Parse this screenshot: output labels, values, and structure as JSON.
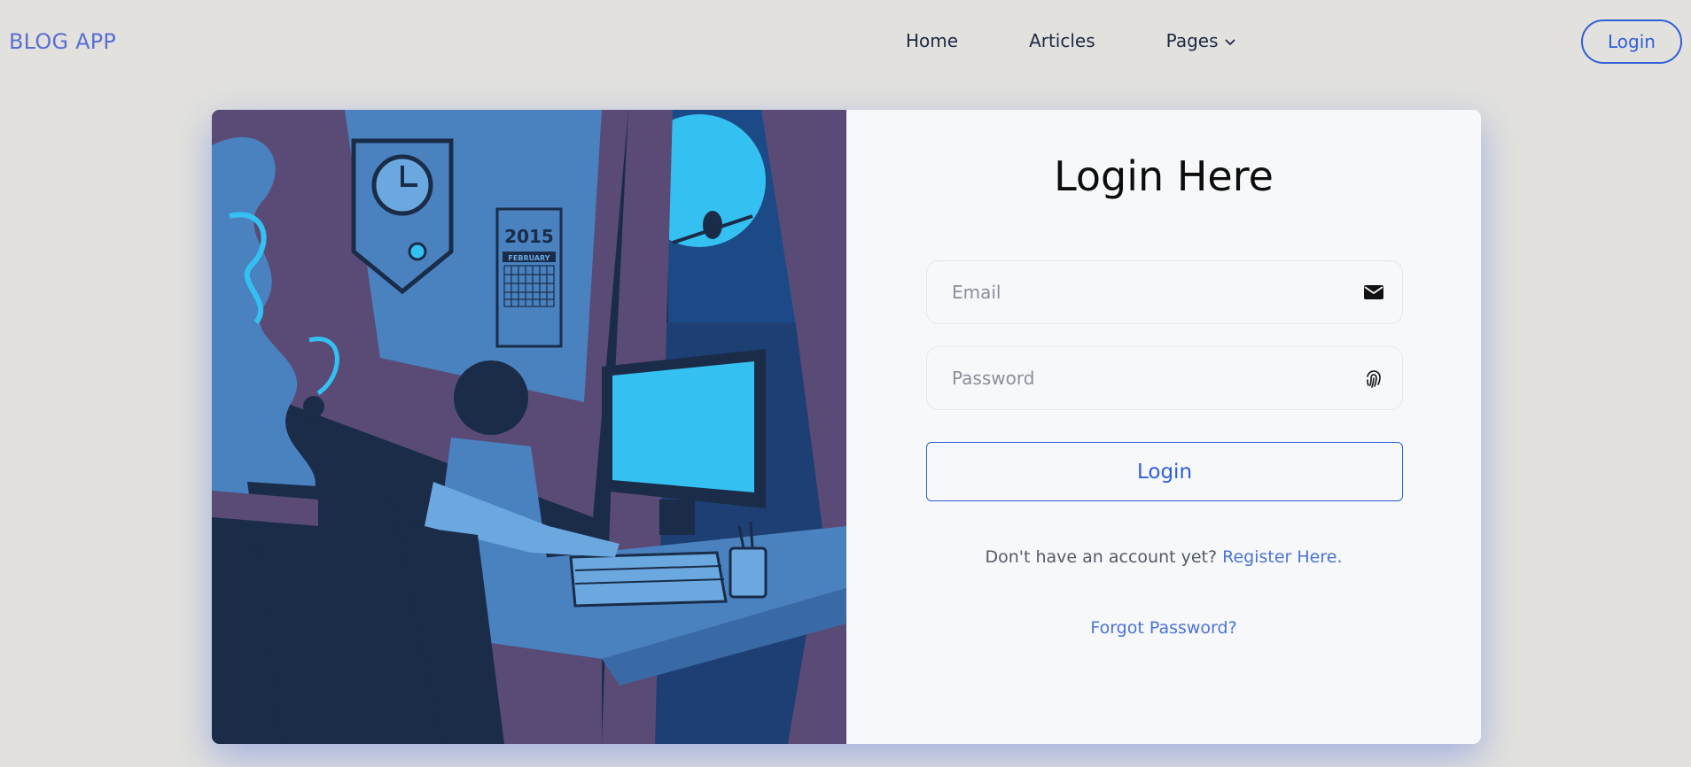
{
  "navbar": {
    "brand": "BLOG APP",
    "links": [
      {
        "label": "Home"
      },
      {
        "label": "Articles"
      },
      {
        "label": "Pages",
        "icon": "chevron-down-icon"
      }
    ],
    "login_label": "Login"
  },
  "illustration": {
    "calendar_year": "2015",
    "calendar_month": "FEBRUARY"
  },
  "form": {
    "title": "Login Here",
    "email_placeholder": "Email",
    "email_icon": "envelope-icon",
    "password_placeholder": "Password",
    "password_icon": "fingerprint-icon",
    "submit_label": "Login",
    "register_prompt": "Don't have an account yet?",
    "register_link": "Register Here.",
    "forgot_link": "Forgot Password?"
  },
  "colors": {
    "accent": "#2f5fd6",
    "brand": "#5b6fd3",
    "link": "#4b72d8",
    "background": "#e2e1dd",
    "panel": "#f6f8fa"
  }
}
